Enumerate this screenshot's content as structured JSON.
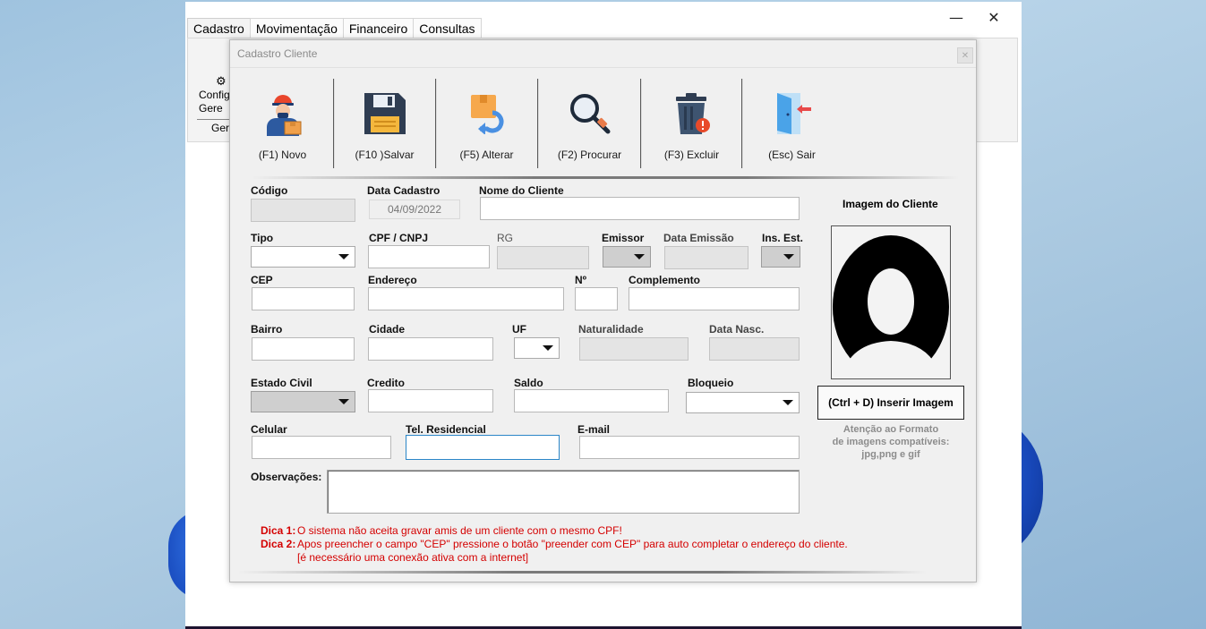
{
  "menu": {
    "tabs": [
      "Cadastro",
      "Movimentação",
      "Financeiro",
      "Consultas"
    ],
    "ribbon": {
      "button_label": "Configurações Gerais",
      "button_label_visible": "Config Gere",
      "group_label": "Gere"
    }
  },
  "window": {
    "minimize": "—",
    "close": "✕"
  },
  "dialog": {
    "title": "Cadastro Cliente",
    "close": "✕",
    "toolbar": [
      {
        "label": "(F1) Novo",
        "icon": "user-worker-icon"
      },
      {
        "label": "(F10 )Salvar",
        "icon": "floppy-save-icon"
      },
      {
        "label": "(F5) Alterar",
        "icon": "box-edit-icon"
      },
      {
        "label": "(F2) Procurar",
        "icon": "magnifier-icon"
      },
      {
        "label": "(F3) Excluir",
        "icon": "trash-icon"
      },
      {
        "label": "(Esc) Sair",
        "icon": "exit-door-icon"
      }
    ]
  },
  "form": {
    "codigo": {
      "label": "Código",
      "value": ""
    },
    "data_cadastro": {
      "label": "Data Cadastro",
      "value": "04/09/2022"
    },
    "nome": {
      "label": "Nome do Cliente",
      "value": ""
    },
    "tipo": {
      "label": "Tipo",
      "value": ""
    },
    "cpf": {
      "label": "CPF / CNPJ",
      "value": ""
    },
    "rg": {
      "label": "RG",
      "value": ""
    },
    "emissor": {
      "label": "Emissor",
      "value": ""
    },
    "data_emissao": {
      "label": "Data Emissão",
      "value": ""
    },
    "ins_est": {
      "label": "Ins. Est.",
      "value": ""
    },
    "cep": {
      "label": "CEP",
      "value": ""
    },
    "endereco": {
      "label": "Endereço",
      "value": ""
    },
    "numero": {
      "label": "Nº",
      "value": ""
    },
    "complemento": {
      "label": "Complemento",
      "value": ""
    },
    "bairro": {
      "label": "Bairro",
      "value": ""
    },
    "cidade": {
      "label": "Cidade",
      "value": ""
    },
    "uf": {
      "label": "UF",
      "value": ""
    },
    "naturalidade": {
      "label": "Naturalidade",
      "value": ""
    },
    "data_nasc": {
      "label": "Data Nasc.",
      "value": ""
    },
    "estado_civil": {
      "label": "Estado Civil",
      "value": ""
    },
    "credito": {
      "label": "Credito",
      "value": ""
    },
    "saldo": {
      "label": "Saldo",
      "value": ""
    },
    "bloqueio": {
      "label": "Bloqueio",
      "value": ""
    },
    "celular": {
      "label": "Celular",
      "value": ""
    },
    "tel_residencial": {
      "label": "Tel. Residencial",
      "value": ""
    },
    "email": {
      "label": "E-mail",
      "value": ""
    },
    "observacoes": {
      "label": "Observações:",
      "value": ""
    }
  },
  "image": {
    "title": "Imagem do Cliente",
    "button": "(Ctrl + D) Inserir Imagem",
    "note_line1": "Atenção ao Formato",
    "note_line2": "de imagens compatíveis:",
    "note_line3": "jpg,png e gif"
  },
  "tips": {
    "tip1_key": "Dica 1:",
    "tip1_text": "O sistema não aceita gravar amis de um cliente com o mesmo CPF!",
    "tip2_key": "Dica 2:",
    "tip2_text": "Apos preencher o campo \"CEP\" pressione o botão \"preender com CEP\" para auto completar o endereço do cliente.",
    "tip2_cont": "[é necessário uma conexão ativa com a internet]"
  },
  "colors": {
    "tip_red": "#d40000",
    "focus_blue": "#2b86c8"
  }
}
